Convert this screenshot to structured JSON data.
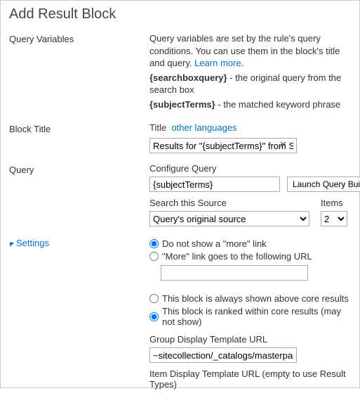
{
  "page": {
    "title": "Add Result Block"
  },
  "queryVariables": {
    "label": "Query Variables",
    "desc1a": "Query variables are set by the rule's query conditions. You can use them in the block's title and query. ",
    "learnMore": "Learn more",
    "desc1b": ".",
    "var1name": "{searchboxquery}",
    "var1desc": " - the original query from the search box",
    "var2name": "{subjectTerms}",
    "var2desc": " - the matched keyword phrase"
  },
  "blockTitle": {
    "label": "Block Title",
    "titleLabel": "Title",
    "otherLanguages": "other languages",
    "value": "Results for \"{subjectTerms}\" from SharePoint"
  },
  "query": {
    "label": "Query",
    "configureLabel": "Configure Query",
    "value": "{subjectTerms}",
    "launchBtn": "Launch Query Builder",
    "searchSourceLabel": "Search this Source",
    "searchSourceValue": "Query's original source",
    "itemsLabel": "Items",
    "itemsValue": "2"
  },
  "settings": {
    "toggleLabel": "Settings",
    "radioNoMore": "Do not show a \"more\" link",
    "radioMoreUrl": "\"More\" link goes to the following URL",
    "moreUrlValue": "",
    "radioAlwaysAbove": "This block is always shown above core results",
    "radioRanked": "This block is ranked within core results (may not show)",
    "groupTemplateLabel": "Group Display Template URL",
    "groupTemplateValue": "~sitecollection/_catalogs/masterpage/Display Templates/Search/Group_Default.js",
    "itemTemplateLabel": "Item Display Template URL (empty to use Result Types)"
  }
}
